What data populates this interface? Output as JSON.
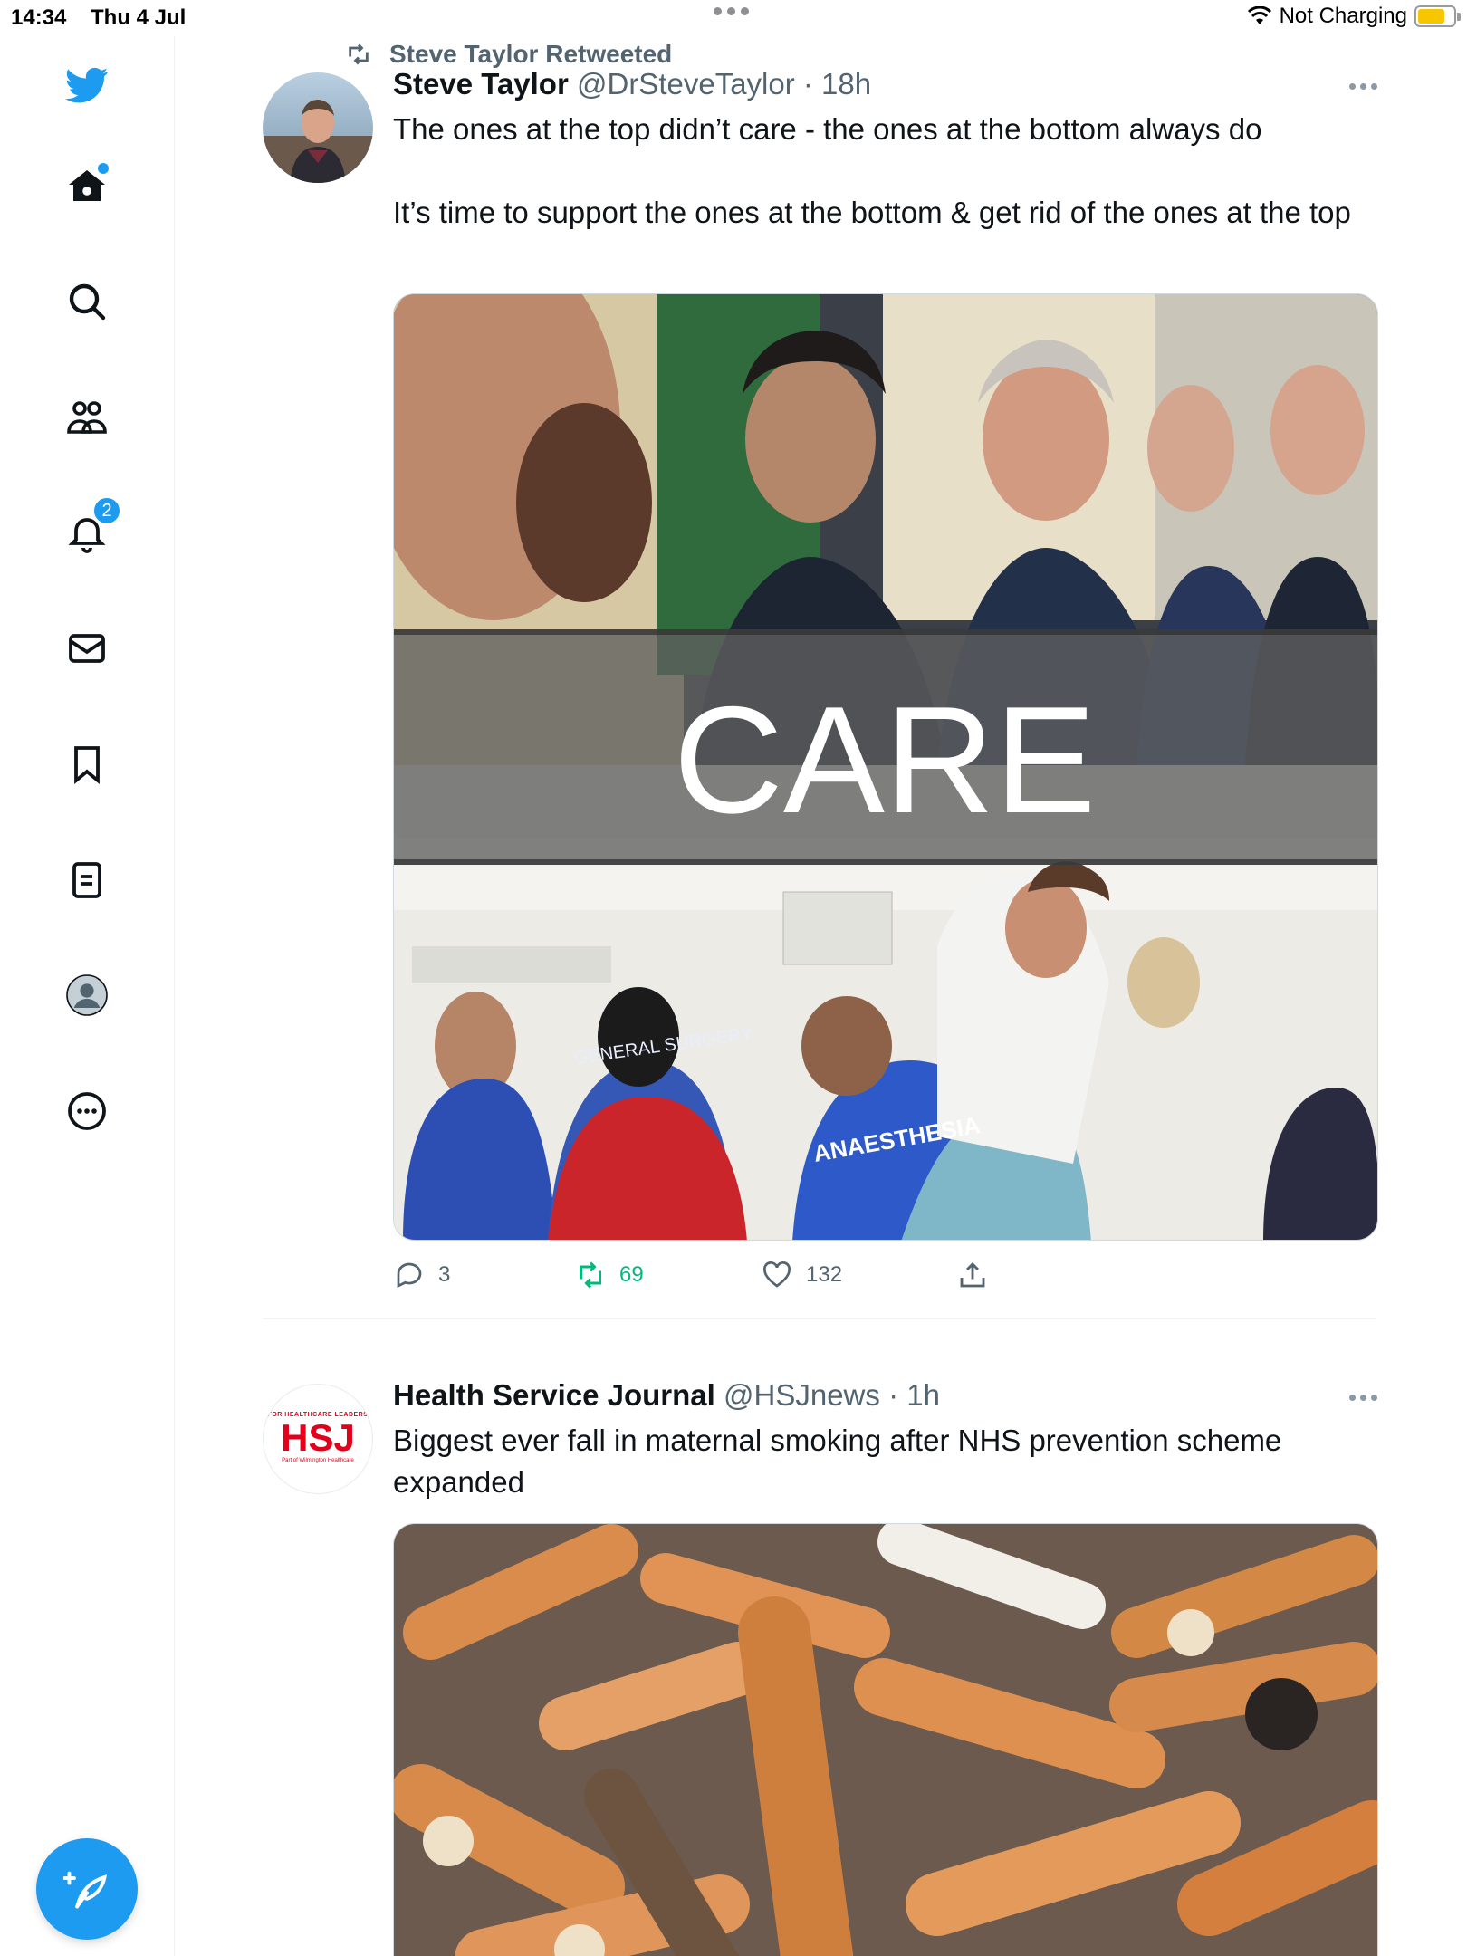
{
  "status_bar": {
    "time": "14:34",
    "date": "Thu 4 Jul",
    "charging": "Not Charging",
    "battery_level": 0.75
  },
  "sidebar": {
    "items": [
      {
        "name": "twitter-logo-icon"
      },
      {
        "name": "home-icon",
        "unread": true
      },
      {
        "name": "search-icon"
      },
      {
        "name": "communities-icon"
      },
      {
        "name": "notifications-icon",
        "badge": "2"
      },
      {
        "name": "messages-icon"
      },
      {
        "name": "bookmarks-icon"
      },
      {
        "name": "lists-icon"
      },
      {
        "name": "profile-icon"
      },
      {
        "name": "more-icon"
      }
    ],
    "compose_icon": "compose-feather-icon"
  },
  "tweets": [
    {
      "retweeted_by": "Steve Taylor Retweeted",
      "name": "Steve Taylor",
      "handle": "@DrSteveTaylor",
      "time": "· 18h",
      "text_line1": "The ones at the top didn’t care - the ones at the bottom always do",
      "text_line2": "It’s time to support the ones at the bottom & get rid of the ones at the top",
      "media": {
        "overlay_text": "CARE",
        "bottom_labels": [
          "GENERAL SURGERY",
          "ANAESTHESIA"
        ]
      },
      "replies": "3",
      "retweets": "69",
      "likes": "132"
    },
    {
      "name": "Health Service Journal",
      "handle": "@HSJnews",
      "time": "· 1h",
      "text_line1": "Biggest ever fall in maternal smoking after NHS prevention scheme expanded",
      "logo": {
        "top": "FOR HEALTHCARE LEADERS",
        "main": "HSJ",
        "bottom": "Part of Wilmington Healthcare"
      }
    }
  ],
  "colors": {
    "accent": "#1d9bf0",
    "retweet_green": "#00ba7c",
    "muted": "#536471"
  }
}
